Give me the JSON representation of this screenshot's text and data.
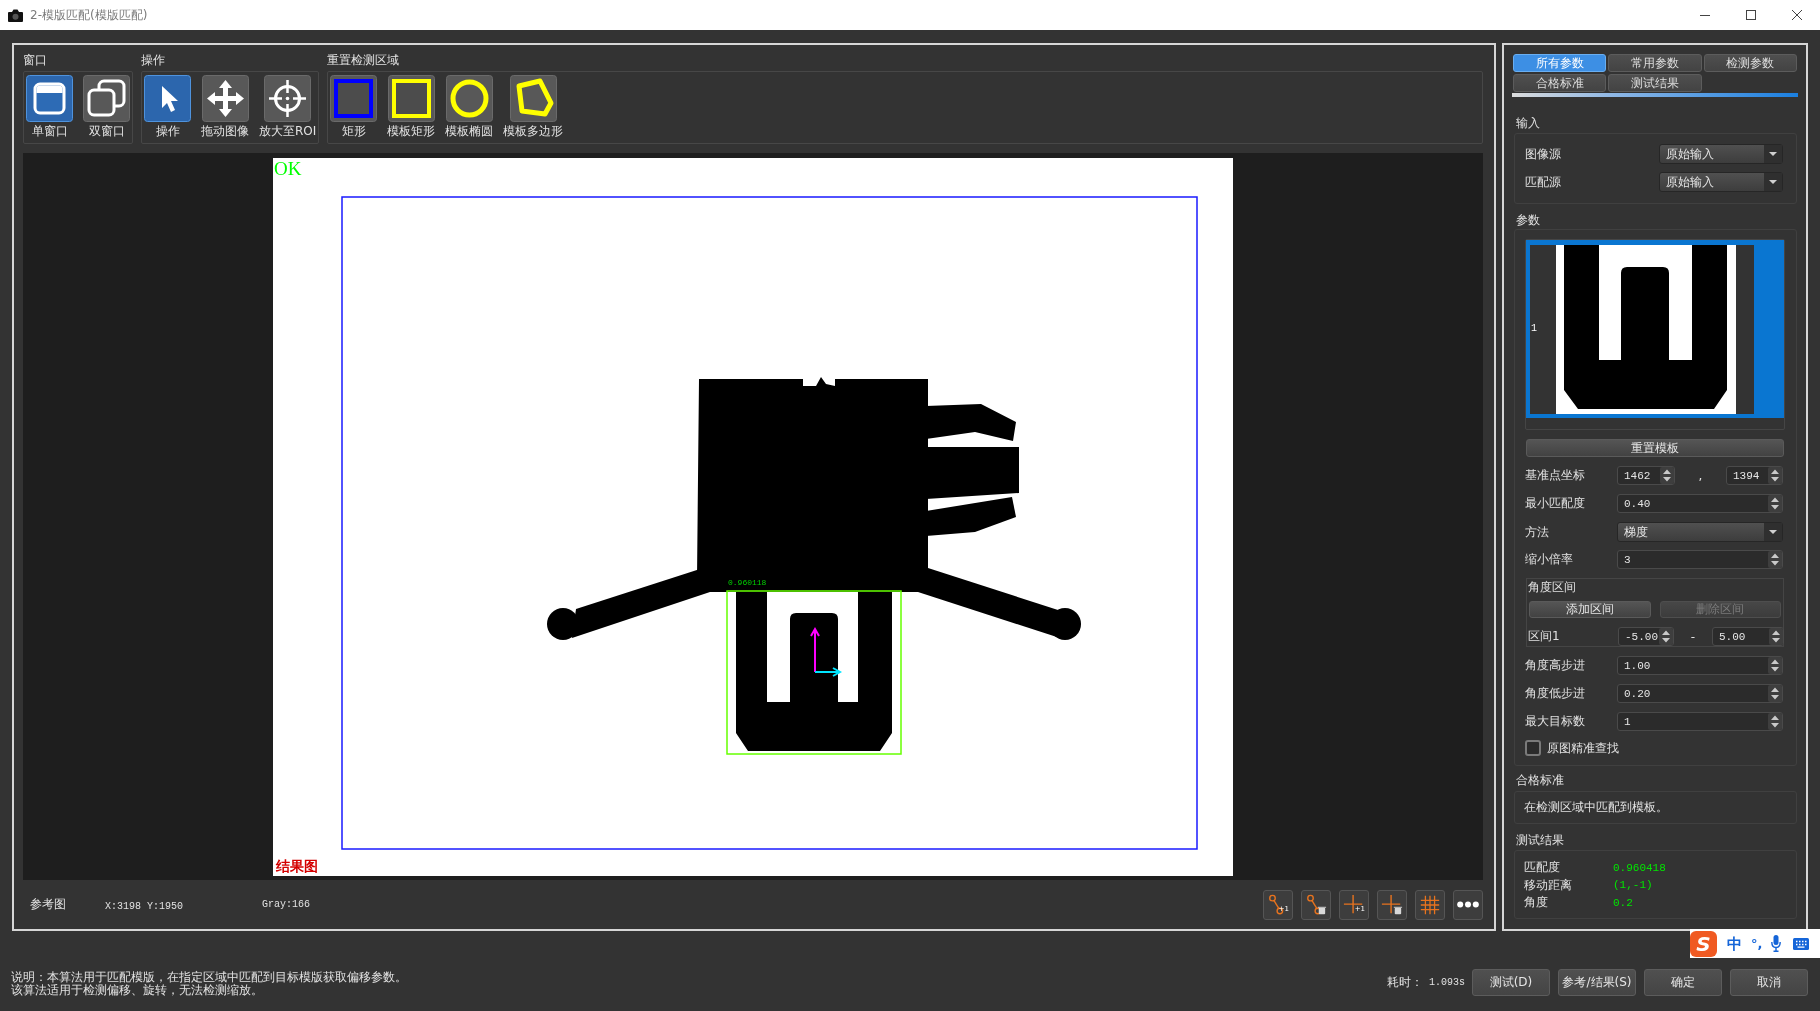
{
  "window": {
    "title": "2-模版匹配(模版匹配)"
  },
  "toolbar": {
    "groups": [
      {
        "label": "窗口",
        "buttons": [
          {
            "label": "单窗口",
            "kind": "single-window",
            "selected": true
          },
          {
            "label": "双窗口",
            "kind": "dual-window",
            "selected": false
          }
        ]
      },
      {
        "label": "操作",
        "buttons": [
          {
            "label": "操作",
            "kind": "pointer",
            "selected": true
          },
          {
            "label": "拖动图像",
            "kind": "move",
            "selected": false
          },
          {
            "label": "放大至ROI",
            "kind": "zoom-roi",
            "selected": false
          }
        ]
      },
      {
        "label": "重置检测区域",
        "buttons": [
          {
            "label": "矩形",
            "kind": "rectangle",
            "color": "#0000ff"
          },
          {
            "label": "模板矩形",
            "kind": "rectangle",
            "color": "#ffff00"
          },
          {
            "label": "模板椭圆",
            "kind": "ellipse",
            "color": "#ffff00"
          },
          {
            "label": "模板多边形",
            "kind": "polygon",
            "color": "#ffff00"
          }
        ]
      }
    ]
  },
  "viewer": {
    "status": "OK",
    "score": "0.960118",
    "caption": "结果图"
  },
  "status_bar": {
    "view": "参考图",
    "position": "X:3198 Y:1950",
    "gray": "Gray:166",
    "tools": [
      {
        "kind": "segment",
        "badge": "+1"
      },
      {
        "kind": "segment-delete"
      },
      {
        "kind": "cross",
        "badge": "+1"
      },
      {
        "kind": "cross-delete"
      },
      {
        "kind": "grid"
      },
      {
        "kind": "more"
      }
    ]
  },
  "panel": {
    "tabs": [
      {
        "label": "所有参数",
        "selected": true
      },
      {
        "label": "常用参数",
        "selected": false
      },
      {
        "label": "检测参数",
        "selected": false
      },
      {
        "label": "合格标准",
        "selected": false
      },
      {
        "label": "测试结果",
        "selected": false
      }
    ],
    "input": {
      "title": "输入",
      "rows": [
        {
          "label": "图像源",
          "value": "原始输入"
        },
        {
          "label": "匹配源",
          "value": "原始输入"
        }
      ]
    },
    "params": {
      "title": "参数",
      "template_label": "1",
      "reset_button": "重置模板",
      "rows": [
        {
          "kind": "pair",
          "label": "基准点坐标",
          "values": [
            "1462",
            "1394"
          ],
          "separator": ","
        },
        {
          "kind": "spin",
          "label": "最小匹配度",
          "value": "0.40"
        },
        {
          "kind": "select",
          "label": "方法",
          "value": "梯度"
        },
        {
          "kind": "spin",
          "label": "缩小倍率",
          "value": "3"
        },
        {
          "kind": "range-group",
          "title": "角度区间",
          "buttons": [
            {
              "label": "添加区间",
              "disabled": false
            },
            {
              "label": "删除区间",
              "disabled": true
            }
          ],
          "ranges": [
            {
              "label": "区间1",
              "values": [
                "-5.00",
                "5.00"
              ],
              "separator": "-"
            }
          ]
        },
        {
          "kind": "spin",
          "label": "角度高步进",
          "value": "1.00"
        },
        {
          "kind": "spin",
          "label": "角度低步进",
          "value": "0.20"
        },
        {
          "kind": "spin",
          "label": "最大目标数",
          "value": "1"
        },
        {
          "kind": "checkbox",
          "label": "原图精准查找",
          "checked": false
        }
      ]
    },
    "criteria": {
      "title": "合格标准",
      "text": "在检测区域中匹配到模板。"
    },
    "results": {
      "title": "测试结果",
      "rows": [
        {
          "label": "匹配度",
          "value": "0.960418"
        },
        {
          "label": "移动距离",
          "value": "(1,-1)"
        },
        {
          "label": "角度",
          "value": "0.2"
        }
      ]
    }
  },
  "footer": {
    "description": [
      "说明：本算法用于匹配模版，在指定区域中匹配到目标模版获取偏移参数。",
      "该算法适用于检测偏移、旋转，无法检测缩放。"
    ],
    "elapsed_label": "耗时：",
    "elapsed": "1.093s",
    "buttons": [
      "测试(D)",
      "参考/结果(S)",
      "确定",
      "取消"
    ]
  },
  "ime": {
    "logo": "S",
    "mode": "中",
    "punctuation": "°,"
  }
}
